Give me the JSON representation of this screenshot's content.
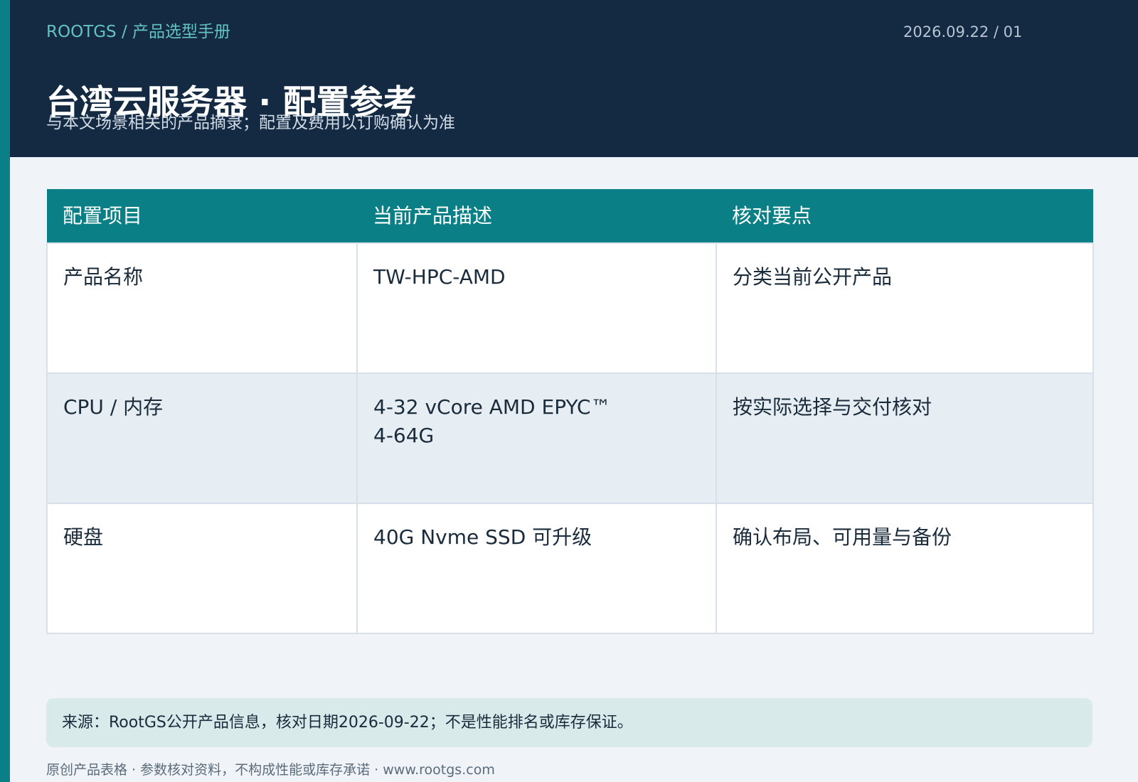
{
  "header": {
    "breadcrumb": "ROOTGS / 产品选型手册",
    "date": "2026.09.22 / 01",
    "title": "台湾云服务器 · 配置参考",
    "subtitle": "与本文场景相关的产品摘录；配置及费用以订购确认为准"
  },
  "table": {
    "columns": [
      "配置项目",
      "当前产品描述",
      "核对要点"
    ],
    "rows": [
      {
        "item": "产品名称",
        "description": [
          "TW-HPC-AMD"
        ],
        "check": "分类当前公开产品"
      },
      {
        "item": "CPU / 内存",
        "description": [
          "4-32 vCore AMD EPYC™",
          "4-64G"
        ],
        "check": "按实际选择与交付核对"
      },
      {
        "item": "硬盘",
        "description": [
          "40G Nvme SSD 可升级"
        ],
        "check": "确认布局、可用量与备份"
      }
    ]
  },
  "source_note": "来源：RootGS公开产品信息，核对日期2026-09-22；不是性能排名或库存保证。",
  "footer": "原创产品表格 · 参数核对资料，不构成性能或库存承诺 · www.rootgs.com",
  "colors": {
    "accent": "#0a7f85",
    "header_background": "#142a43",
    "breadcrumb": "#63c3c0",
    "note_background": "#d8ebea"
  }
}
